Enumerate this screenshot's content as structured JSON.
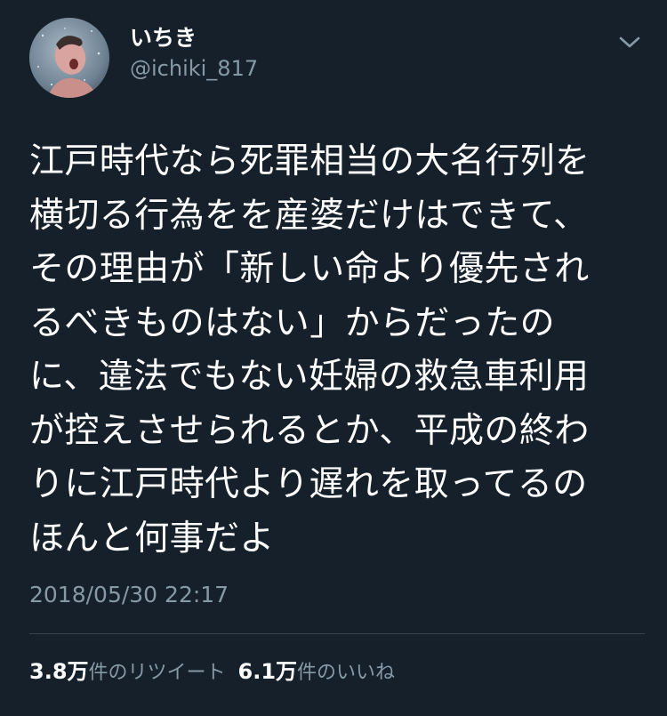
{
  "author": {
    "display_name": "いちき",
    "handle": "@ichiki_817",
    "avatar_icon": "user-avatar"
  },
  "tweet": {
    "lines": [
      "江戸時代なら死罪相当の大名行列を",
      "横切る行為をを産婆だけはできて、",
      "その理由が「新しい命より優先され",
      "るべきものはない」からだったの",
      "に、違法でもない妊婦の救急車利用",
      "が控えさせられるとか、平成の終わ",
      "りに江戸時代より遅れを取ってるの",
      "ほんと何事だよ"
    ],
    "timestamp": "2018/05/30 22:17"
  },
  "stats": {
    "retweets_count": "3.8万",
    "retweets_label": "件のリツイート",
    "likes_count": "6.1万",
    "likes_label": "件のいいね"
  },
  "colors": {
    "background": "#15202b",
    "text_primary": "#ffffff",
    "text_secondary": "#8899a6",
    "divider": "#38444d"
  },
  "icons": {
    "menu": "chevron-down-icon"
  }
}
